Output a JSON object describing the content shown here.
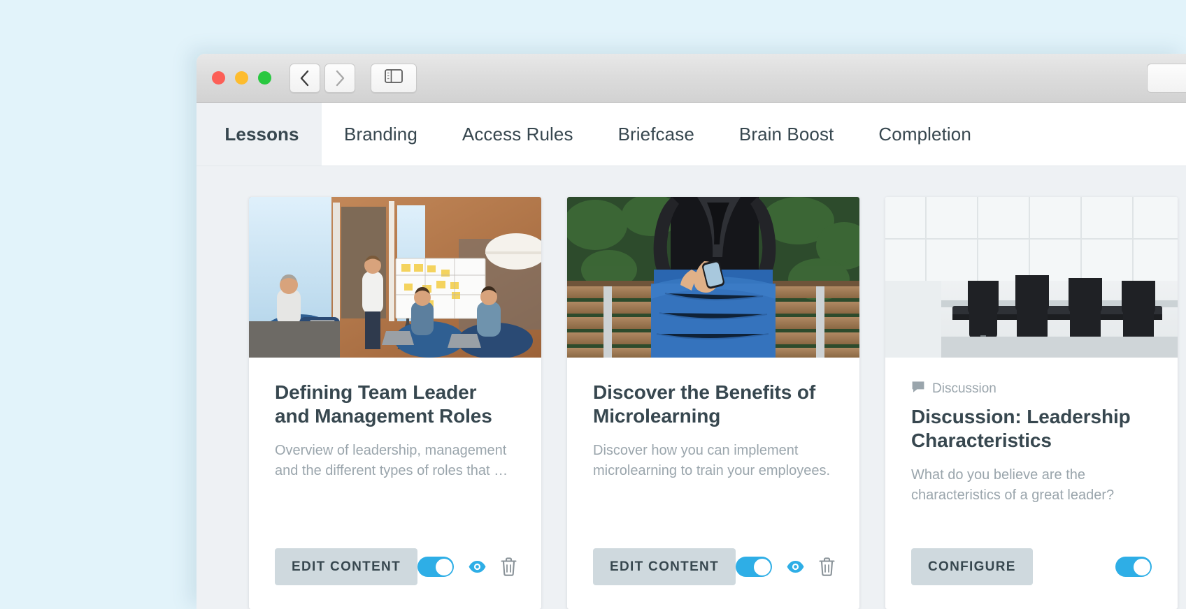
{
  "window": {
    "traffic_lights": [
      {
        "name": "close",
        "color": "#fc5f57"
      },
      {
        "name": "minimize",
        "color": "#fdbc2e"
      },
      {
        "name": "zoom",
        "color": "#29c840"
      }
    ],
    "back_label": "Back",
    "forward_label": "Forward",
    "sidebar_label": "Show Sidebar"
  },
  "tabs": [
    {
      "label": "Lessons",
      "active": true
    },
    {
      "label": "Branding",
      "active": false
    },
    {
      "label": "Access Rules",
      "active": false
    },
    {
      "label": "Briefcase",
      "active": false
    },
    {
      "label": "Brain Boost",
      "active": false
    },
    {
      "label": "Completion",
      "active": false
    }
  ],
  "cards": [
    {
      "kicker": "",
      "title": "Defining Team Leader and Management Roles",
      "description": "Overview of leadership, management and the different types of roles that …",
      "action_label": "EDIT CONTENT",
      "toggle_on": true,
      "has_preview_icon": true,
      "has_delete_icon": true,
      "thumb": "team-meeting-whiteboard"
    },
    {
      "kicker": "",
      "title": "Discover the Benefits of Microlearning",
      "description": "Discover how you can implement microlearning to train your employees.",
      "action_label": "EDIT CONTENT",
      "toggle_on": true,
      "has_preview_icon": true,
      "has_delete_icon": true,
      "thumb": "person-phone-bench"
    },
    {
      "kicker": "Discussion",
      "title": "Discussion: Leadership Characteristics",
      "description": "What do you believe are the characteristics of a great leader?",
      "action_label": "CONFIGURE",
      "toggle_on": true,
      "has_preview_icon": false,
      "has_delete_icon": false,
      "thumb": "empty-boardroom"
    }
  ],
  "colors": {
    "page_background": "#e2f3fa",
    "app_background": "#eef1f4",
    "card_background": "#ffffff",
    "title_text": "#37474f",
    "muted_text": "#9aa5ac",
    "accent_blue": "#2eaee6",
    "button_background": "#cfd9de"
  }
}
